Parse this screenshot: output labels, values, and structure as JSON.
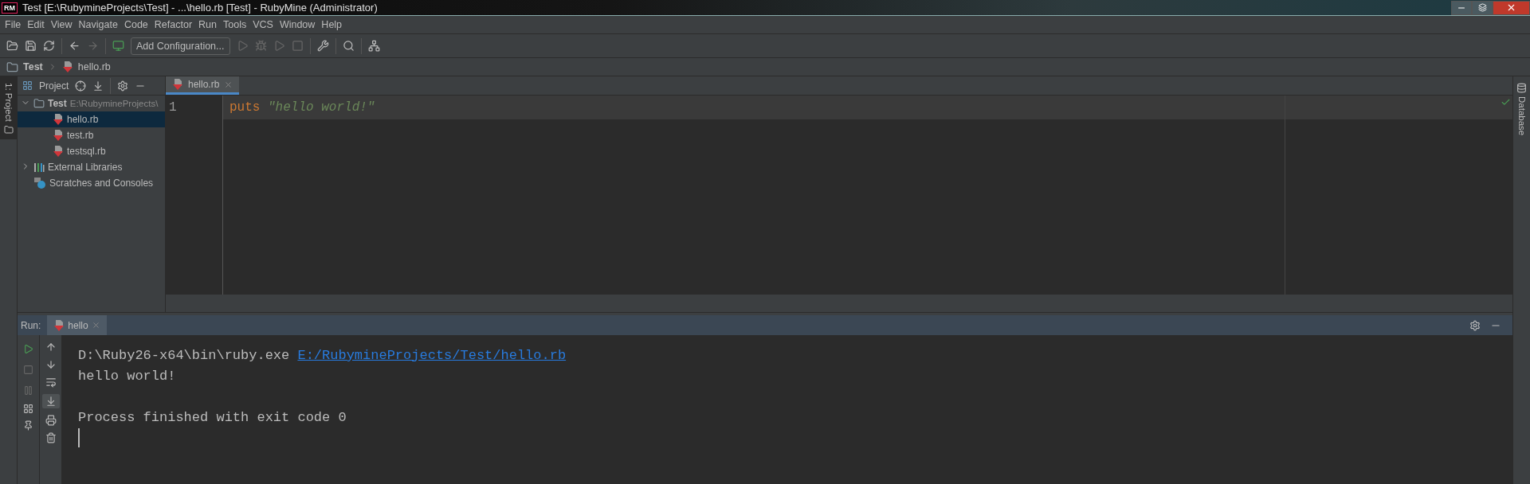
{
  "window": {
    "title": "Test [E:\\RubymineProjects\\Test] - ...\\hello.rb [Test] - RubyMine (Administrator)",
    "app_badge": "RM"
  },
  "menu": [
    "File",
    "Edit",
    "View",
    "Navigate",
    "Code",
    "Refactor",
    "Run",
    "Tools",
    "VCS",
    "Window",
    "Help"
  ],
  "toolbar": {
    "run_config": "Add Configuration..."
  },
  "breadcrumb": [
    "Test",
    "hello.rb"
  ],
  "left_stripe": [
    {
      "label": "1: Project",
      "selected": true
    }
  ],
  "project": {
    "title": "Project",
    "tree": [
      {
        "label": "Test",
        "path": "E:\\RubymineProjects\\",
        "kind": "folder",
        "expanded": true,
        "selected": false,
        "children": [
          {
            "label": "hello.rb",
            "kind": "ruby",
            "selected": true
          },
          {
            "label": "test.rb",
            "kind": "ruby",
            "selected": false
          },
          {
            "label": "testsql.rb",
            "kind": "ruby",
            "selected": false
          }
        ]
      },
      {
        "label": "External Libraries",
        "kind": "library",
        "expanded": false,
        "selected": false
      },
      {
        "label": "Scratches and Consoles",
        "kind": "scratch",
        "selected": false
      }
    ]
  },
  "editor": {
    "tabs": [
      {
        "label": "hello.rb",
        "selected": true
      }
    ],
    "lines": [
      {
        "number": "1",
        "keyword": "puts",
        "string": "\"hello world!\"",
        "current": true
      }
    ]
  },
  "right_stripe": [
    {
      "label": "Database"
    }
  ],
  "run": {
    "label": "Run:",
    "tabs": [
      {
        "label": "hello",
        "selected": true
      }
    ],
    "actions": [
      {
        "kind": "rerun",
        "disabled": false
      },
      {
        "kind": "stop",
        "disabled": true
      },
      {
        "kind": "pause",
        "disabled": true
      }
    ],
    "console": [
      {
        "kind": "command",
        "text": "D:\\Ruby26-x64\\bin\\ruby.exe ",
        "link": "E:/RubymineProjects/Test/hello.rb"
      },
      {
        "kind": "output",
        "text": "hello world!"
      },
      {
        "kind": "blank"
      },
      {
        "kind": "output",
        "text": "Process finished with exit code 0"
      },
      {
        "kind": "cursor"
      }
    ]
  }
}
